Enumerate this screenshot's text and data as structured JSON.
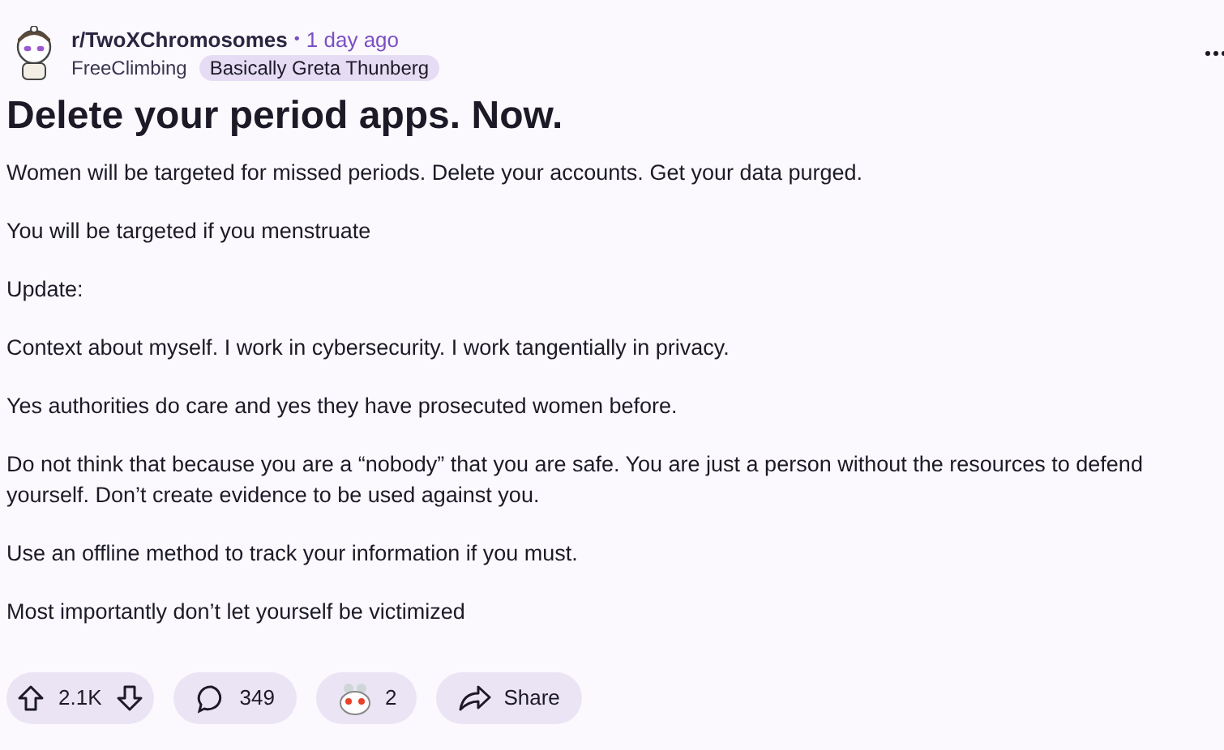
{
  "post": {
    "subreddit": "r/TwoXChromosomes",
    "separator": "•",
    "time": "1 day ago",
    "author": "FreeClimbing",
    "flair": "Basically Greta Thunberg",
    "title": "Delete your period apps. Now.",
    "paragraphs": [
      "Women will be targeted for missed periods. Delete your accounts. Get your data purged.",
      "You will be targeted if you menstruate",
      "Update:",
      "Context about myself. I work in cybersecurity. I work tangentially in privacy.",
      "Yes authorities do care and yes they have prosecuted women before.",
      "Do not think that because you are a “nobody” that you are safe. You are just a person without the resources to defend yourself. Don’t create evidence to be used against you.",
      "Use an offline method to track your information if you must.",
      "Most importantly don’t let yourself be victimized"
    ]
  },
  "actions": {
    "votes": "2.1K",
    "comments": "349",
    "awards": "2",
    "share": "Share"
  }
}
